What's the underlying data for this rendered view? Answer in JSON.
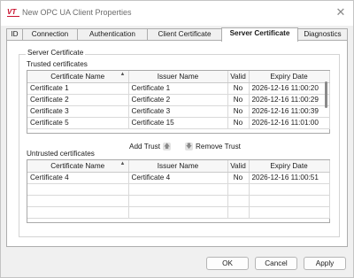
{
  "window": {
    "title": "New OPC UA Client Properties",
    "logo_text": "VT",
    "close_glyph": "✕"
  },
  "tabs": [
    {
      "label": "ID",
      "active": false
    },
    {
      "label": "Connection",
      "active": false
    },
    {
      "label": "Authentication",
      "active": false
    },
    {
      "label": "Client Certificate",
      "active": false
    },
    {
      "label": "Server Certificate",
      "active": true
    },
    {
      "label": "Diagnostics",
      "active": false
    }
  ],
  "server_certificate": {
    "group_label": "Server Certificate",
    "trusted_label": "Trusted certificates",
    "untrusted_label": "Untrusted certificates",
    "columns": [
      "Certificate Name",
      "Issuer Name",
      "Valid",
      "Expiry Date"
    ],
    "sort_glyph": "▲",
    "trusted_rows": [
      {
        "name": "Certificate 1",
        "issuer": "Certificate 1",
        "valid": "No",
        "expiry": "2026-12-16 11:00:20"
      },
      {
        "name": "Certificate 2",
        "issuer": "Certificate 2",
        "valid": "No",
        "expiry": "2026-12-16 11:00:29"
      },
      {
        "name": "Certificate 3",
        "issuer": "Certificate 3",
        "valid": "No",
        "expiry": "2026-12-16 11:00:39"
      },
      {
        "name": "Certificate 5",
        "issuer": "Certificate 15",
        "valid": "No",
        "expiry": "2026-12-16 11:01:00"
      }
    ],
    "untrusted_rows": [
      {
        "name": "Certificate 4",
        "issuer": "Certificate 4",
        "valid": "No",
        "expiry": "2026-12-16 11:00:51"
      },
      {
        "name": "",
        "issuer": "",
        "valid": "",
        "expiry": ""
      },
      {
        "name": "",
        "issuer": "",
        "valid": "",
        "expiry": ""
      },
      {
        "name": "",
        "issuer": "",
        "valid": "",
        "expiry": ""
      }
    ],
    "add_trust_label": "Add Trust",
    "add_trust_icon": "arrow-up-icon",
    "remove_trust_label": "Remove Trust",
    "remove_trust_icon": "arrow-down-icon"
  },
  "footer": {
    "ok_label": "OK",
    "cancel_label": "Cancel",
    "apply_label": "Apply"
  }
}
